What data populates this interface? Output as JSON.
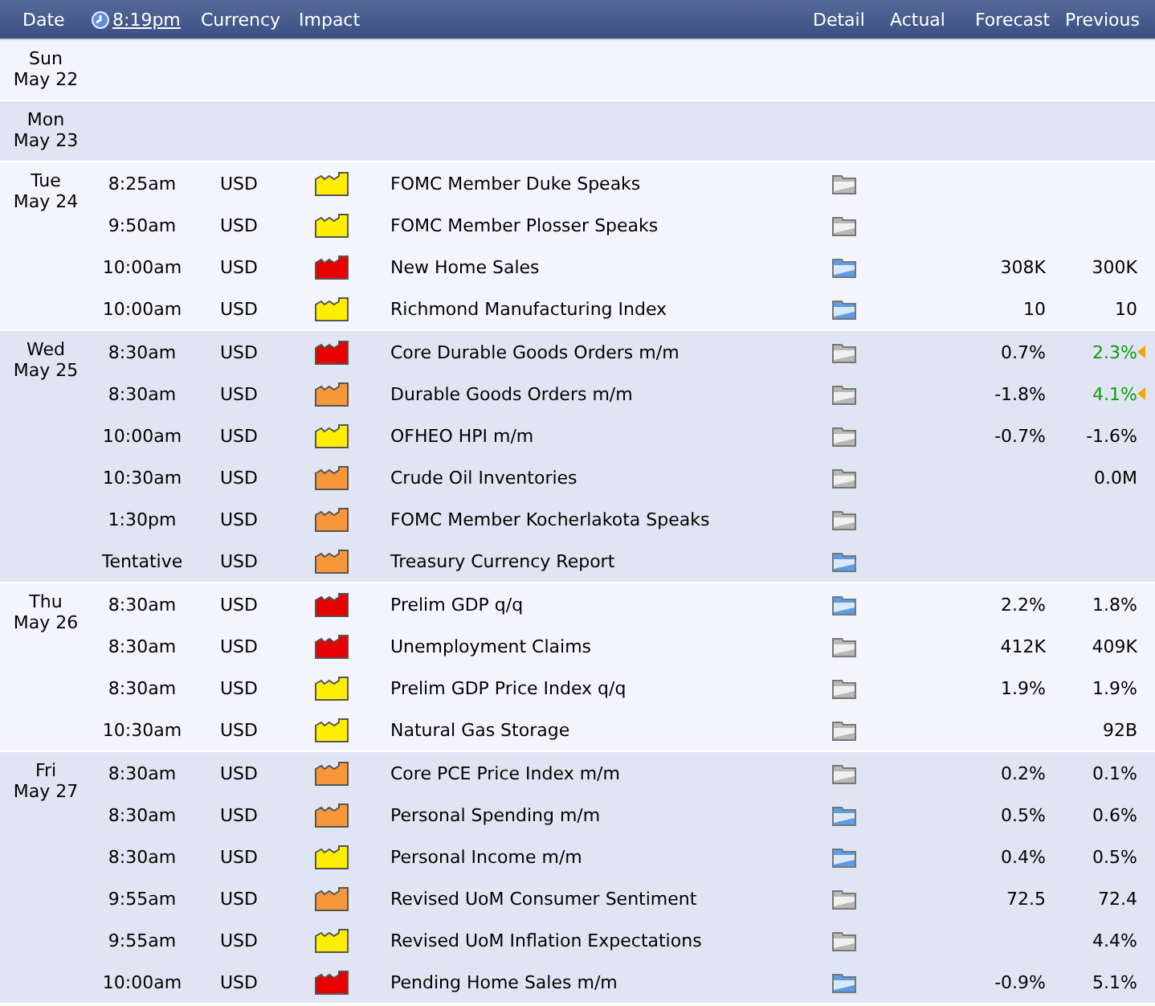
{
  "header": {
    "date": "Date",
    "time": "8:19pm",
    "currency": "Currency",
    "impact": "Impact",
    "detail": "Detail",
    "actual": "Actual",
    "forecast": "Forecast",
    "previous": "Previous"
  },
  "days": [
    {
      "weekday": "Sun",
      "date": "May 22"
    },
    {
      "weekday": "Mon",
      "date": "May 23"
    },
    {
      "weekday": "Tue",
      "date": "May 24",
      "events": [
        {
          "time": "8:25am",
          "currency": "USD",
          "kind": "low",
          "title": "FOMC Member Duke Speaks",
          "detail_updated": false
        },
        {
          "time": "9:50am",
          "currency": "USD",
          "kind": "low",
          "title": "FOMC Member Plosser Speaks",
          "detail_updated": false
        },
        {
          "time": "10:00am",
          "currency": "USD",
          "kind": "high",
          "title": "New Home Sales",
          "detail_updated": true,
          "forecast": "308K",
          "previous": "300K",
          "revised": false
        },
        {
          "time": "10:00am",
          "currency": "USD",
          "kind": "low",
          "title": "Richmond Manufacturing Index",
          "detail_updated": true,
          "forecast": "10",
          "previous": "10",
          "revised": false
        }
      ]
    },
    {
      "weekday": "Wed",
      "date": "May 25",
      "events": [
        {
          "time": "8:30am",
          "currency": "USD",
          "kind": "high",
          "title": "Core Durable Goods Orders m/m",
          "detail_updated": false,
          "forecast": "0.7%",
          "previous": "2.3%",
          "revised": true
        },
        {
          "time": "8:30am",
          "currency": "USD",
          "kind": "medium",
          "title": "Durable Goods Orders m/m",
          "detail_updated": false,
          "forecast": "-1.8%",
          "previous": "4.1%",
          "revised": true
        },
        {
          "time": "10:00am",
          "currency": "USD",
          "kind": "low",
          "title": "OFHEO HPI m/m",
          "detail_updated": false,
          "forecast": "-0.7%",
          "previous": "-1.6%",
          "revised": false
        },
        {
          "time": "10:30am",
          "currency": "USD",
          "kind": "medium",
          "title": "Crude Oil Inventories",
          "detail_updated": false,
          "previous": "0.0M",
          "revised": false
        },
        {
          "time": "1:30pm",
          "currency": "USD",
          "kind": "medium",
          "title": "FOMC Member Kocherlakota Speaks",
          "detail_updated": false
        },
        {
          "time": "Tentative",
          "currency": "USD",
          "kind": "medium",
          "title": "Treasury Currency Report",
          "detail_updated": true
        }
      ]
    },
    {
      "weekday": "Thu",
      "date": "May 26",
      "events": [
        {
          "time": "8:30am",
          "currency": "USD",
          "kind": "high",
          "title": "Prelim GDP q/q",
          "detail_updated": true,
          "forecast": "2.2%",
          "previous": "1.8%",
          "revised": false
        },
        {
          "time": "8:30am",
          "currency": "USD",
          "kind": "high",
          "title": "Unemployment Claims",
          "detail_updated": false,
          "forecast": "412K",
          "previous": "409K",
          "revised": false
        },
        {
          "time": "8:30am",
          "currency": "USD",
          "kind": "low",
          "title": "Prelim GDP Price Index q/q",
          "detail_updated": false,
          "forecast": "1.9%",
          "previous": "1.9%",
          "revised": false
        },
        {
          "time": "10:30am",
          "currency": "USD",
          "kind": "low",
          "title": "Natural Gas Storage",
          "detail_updated": false,
          "previous": "92B",
          "revised": false
        }
      ]
    },
    {
      "weekday": "Fri",
      "date": "May 27",
      "events": [
        {
          "time": "8:30am",
          "currency": "USD",
          "kind": "medium",
          "title": "Core PCE Price Index m/m",
          "detail_updated": false,
          "forecast": "0.2%",
          "previous": "0.1%",
          "revised": false
        },
        {
          "time": "8:30am",
          "currency": "USD",
          "kind": "medium",
          "title": "Personal Spending m/m",
          "detail_updated": true,
          "forecast": "0.5%",
          "previous": "0.6%",
          "revised": false
        },
        {
          "time": "8:30am",
          "currency": "USD",
          "kind": "low",
          "title": "Personal Income m/m",
          "detail_updated": true,
          "forecast": "0.4%",
          "previous": "0.5%",
          "revised": false
        },
        {
          "time": "9:55am",
          "currency": "USD",
          "kind": "medium",
          "title": "Revised UoM Consumer Sentiment",
          "detail_updated": false,
          "forecast": "72.5",
          "previous": "72.4",
          "revised": false
        },
        {
          "time": "9:55am",
          "currency": "USD",
          "kind": "low",
          "title": "Revised UoM Inflation Expectations",
          "detail_updated": false,
          "previous": "4.4%",
          "revised": false
        },
        {
          "time": "10:00am",
          "currency": "USD",
          "kind": "high",
          "title": "Pending Home Sales m/m",
          "detail_updated": true,
          "forecast": "-0.9%",
          "previous": "5.1%",
          "revised": false
        }
      ]
    }
  ]
}
